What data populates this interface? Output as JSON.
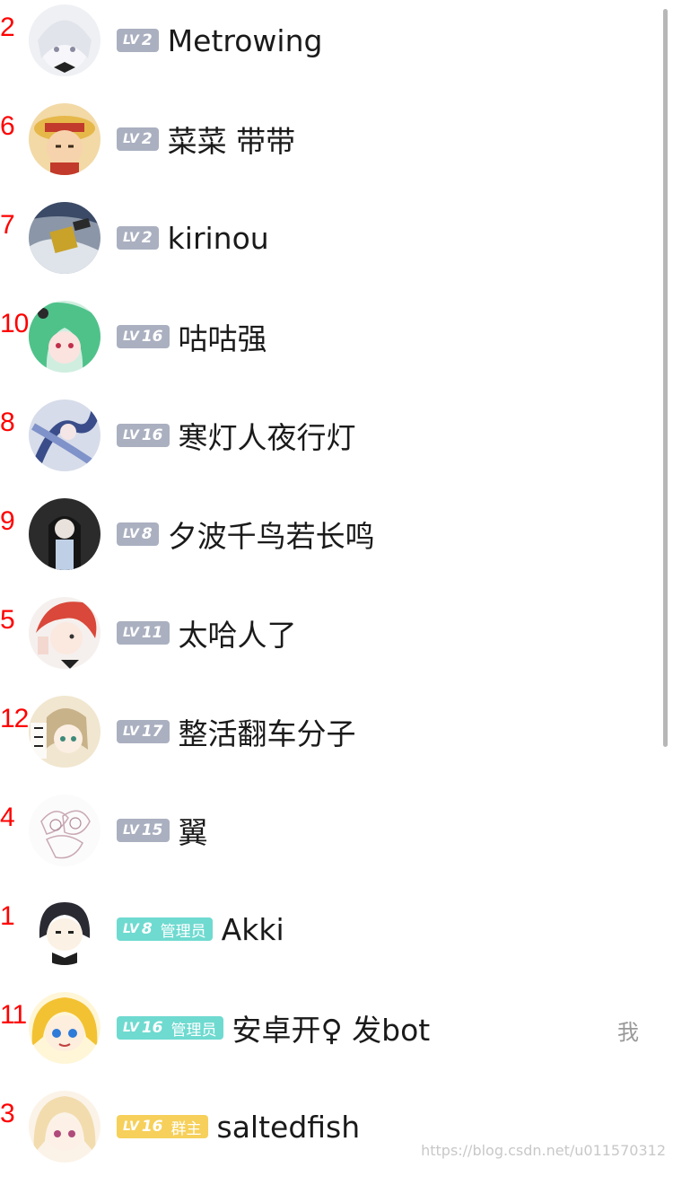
{
  "members": [
    {
      "index": "2",
      "level": "2",
      "role": "",
      "name": "Metrowing",
      "badge_color": "#aab0c0",
      "avatar_icon": "white-haired-maid-avatar-icon"
    },
    {
      "index": "6",
      "level": "2",
      "role": "",
      "name": "菜菜 带带",
      "badge_color": "#aab0c0",
      "avatar_icon": "straw-hat-avatar-icon"
    },
    {
      "index": "7",
      "level": "2",
      "role": "",
      "name": "kirinou",
      "badge_color": "#aab0c0",
      "avatar_icon": "satellite-avatar-icon"
    },
    {
      "index": "10",
      "level": "16",
      "role": "",
      "name": "咕咕强",
      "badge_color": "#aab0c0",
      "avatar_icon": "green-haired-girl-avatar-icon"
    },
    {
      "index": "8",
      "level": "16",
      "role": "",
      "name": "寒灯人夜行灯",
      "badge_color": "#aab0c0",
      "avatar_icon": "blue-illustration-avatar-icon"
    },
    {
      "index": "9",
      "level": "8",
      "role": "",
      "name": "夕波千鸟若长鸣",
      "badge_color": "#aab0c0",
      "avatar_icon": "dark-haired-girl-avatar-icon"
    },
    {
      "index": "5",
      "level": "11",
      "role": "",
      "name": "太哈人了",
      "badge_color": "#aab0c0",
      "avatar_icon": "red-haired-boy-avatar-icon"
    },
    {
      "index": "12",
      "level": "17",
      "role": "",
      "name": "整活翻车分子",
      "badge_color": "#aab0c0",
      "avatar_icon": "sticker-girl-avatar-icon"
    },
    {
      "index": "4",
      "level": "15",
      "role": "",
      "name": "翼",
      "badge_color": "#aab0c0",
      "avatar_icon": "sketch-avatar-icon"
    },
    {
      "index": "1",
      "level": "8",
      "role": "管理员",
      "name": "Akki",
      "badge_color": "#6fdad0",
      "avatar_icon": "chibi-dark-hair-avatar-icon"
    },
    {
      "index": "11",
      "level": "16",
      "role": "管理员",
      "name": "安卓开♀ 发bot",
      "badge_color": "#6fdad0",
      "avatar_icon": "blonde-blue-eyes-avatar-icon",
      "me_label": "我"
    },
    {
      "index": "3",
      "level": "16",
      "role": "群主",
      "name": "saltedfish",
      "badge_color": "#f6d05a",
      "avatar_icon": "blonde-girl-avatar-icon"
    }
  ],
  "lv_prefix": "LV",
  "watermark": "https://blog.csdn.net/u011570312",
  "colors": {
    "index_red": "#ff0000",
    "badge_gray": "#aab0c0",
    "badge_admin": "#6fdad0",
    "badge_owner": "#f6d05a"
  }
}
